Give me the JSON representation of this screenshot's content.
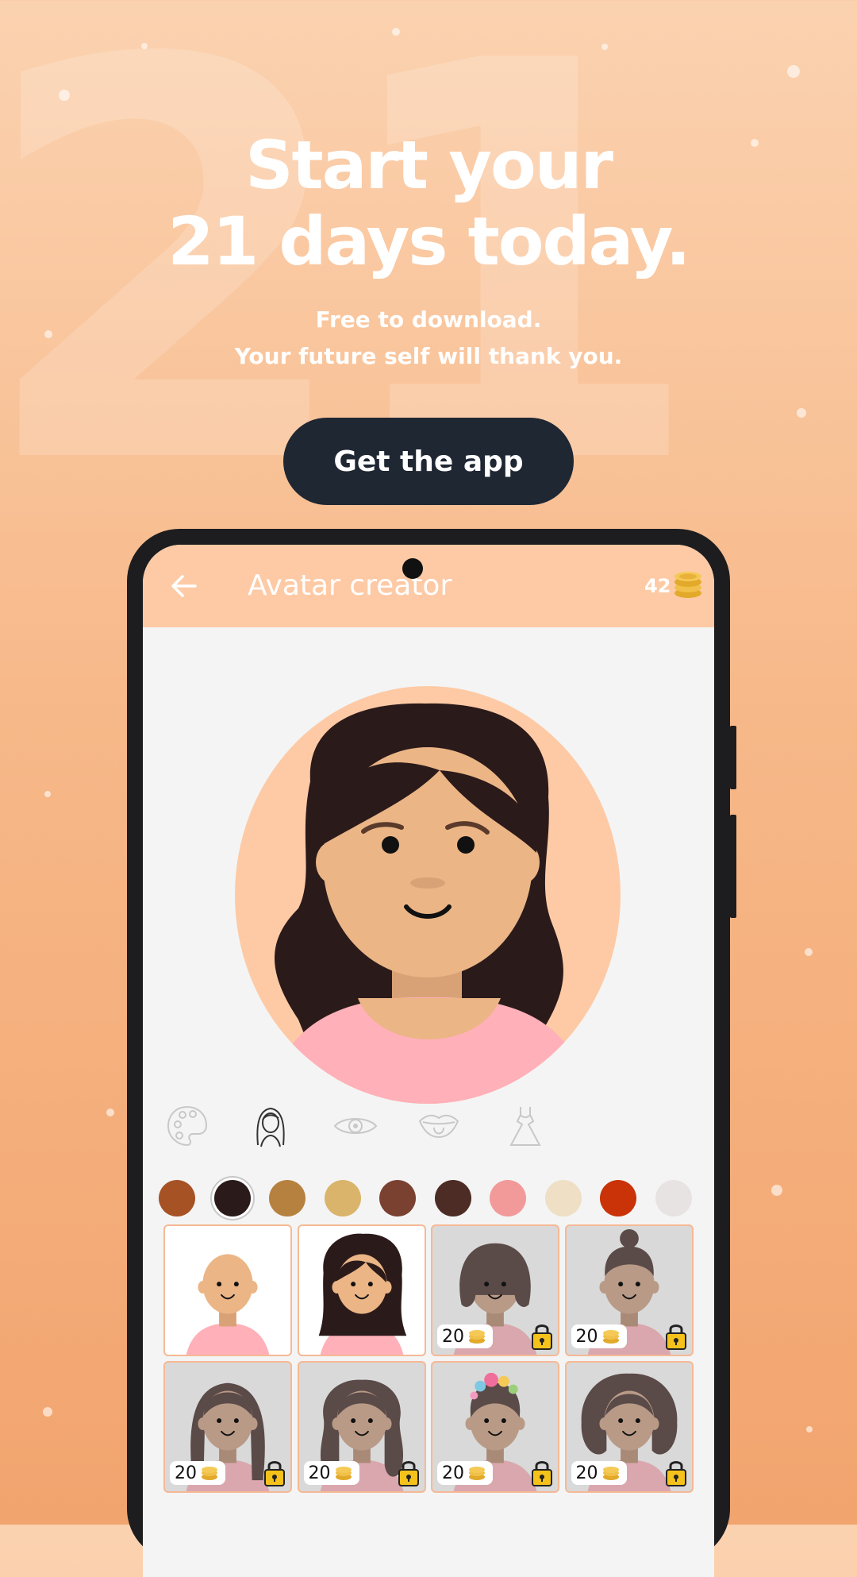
{
  "hero": {
    "background_numeral": "21",
    "headline_line1": "Start your",
    "headline_line2": "21 days today.",
    "sub_line1": "Free to download.",
    "sub_line2": "Your future self will thank you.",
    "cta_label": "Get the app"
  },
  "app": {
    "title": "Avatar creator",
    "coins": "42",
    "back_icon": "arrow-left-icon",
    "coin_icon": "coins-stack-icon"
  },
  "categories": [
    {
      "name": "skin-palette",
      "icon": "palette-icon",
      "selected": false
    },
    {
      "name": "hair",
      "icon": "hair-person-icon",
      "selected": true
    },
    {
      "name": "eyes",
      "icon": "eye-icon",
      "selected": false
    },
    {
      "name": "mouth",
      "icon": "mouth-icon",
      "selected": false
    },
    {
      "name": "clothes",
      "icon": "dress-icon",
      "selected": false
    }
  ],
  "hair_colors": [
    "#a65224",
    "#2b1a1a",
    "#b6813f",
    "#d9b46a",
    "#7a4030",
    "#4c2c24",
    "#f2999a",
    "#eedfc5",
    "#c93307",
    "#e8e3e3"
  ],
  "selected_hair_color": "#2b1a1a",
  "hair_options": [
    {
      "style": "bald",
      "price": null,
      "locked": false
    },
    {
      "style": "long-wavy",
      "price": null,
      "locked": false
    },
    {
      "style": "bob",
      "price": "20",
      "locked": true
    },
    {
      "style": "bun",
      "price": "20",
      "locked": true
    },
    {
      "style": "long-straight",
      "price": "20",
      "locked": true
    },
    {
      "style": "long-curly",
      "price": "20",
      "locked": true
    },
    {
      "style": "flower-crown",
      "price": "20",
      "locked": true
    },
    {
      "style": "afro",
      "price": "20",
      "locked": true
    }
  ]
}
